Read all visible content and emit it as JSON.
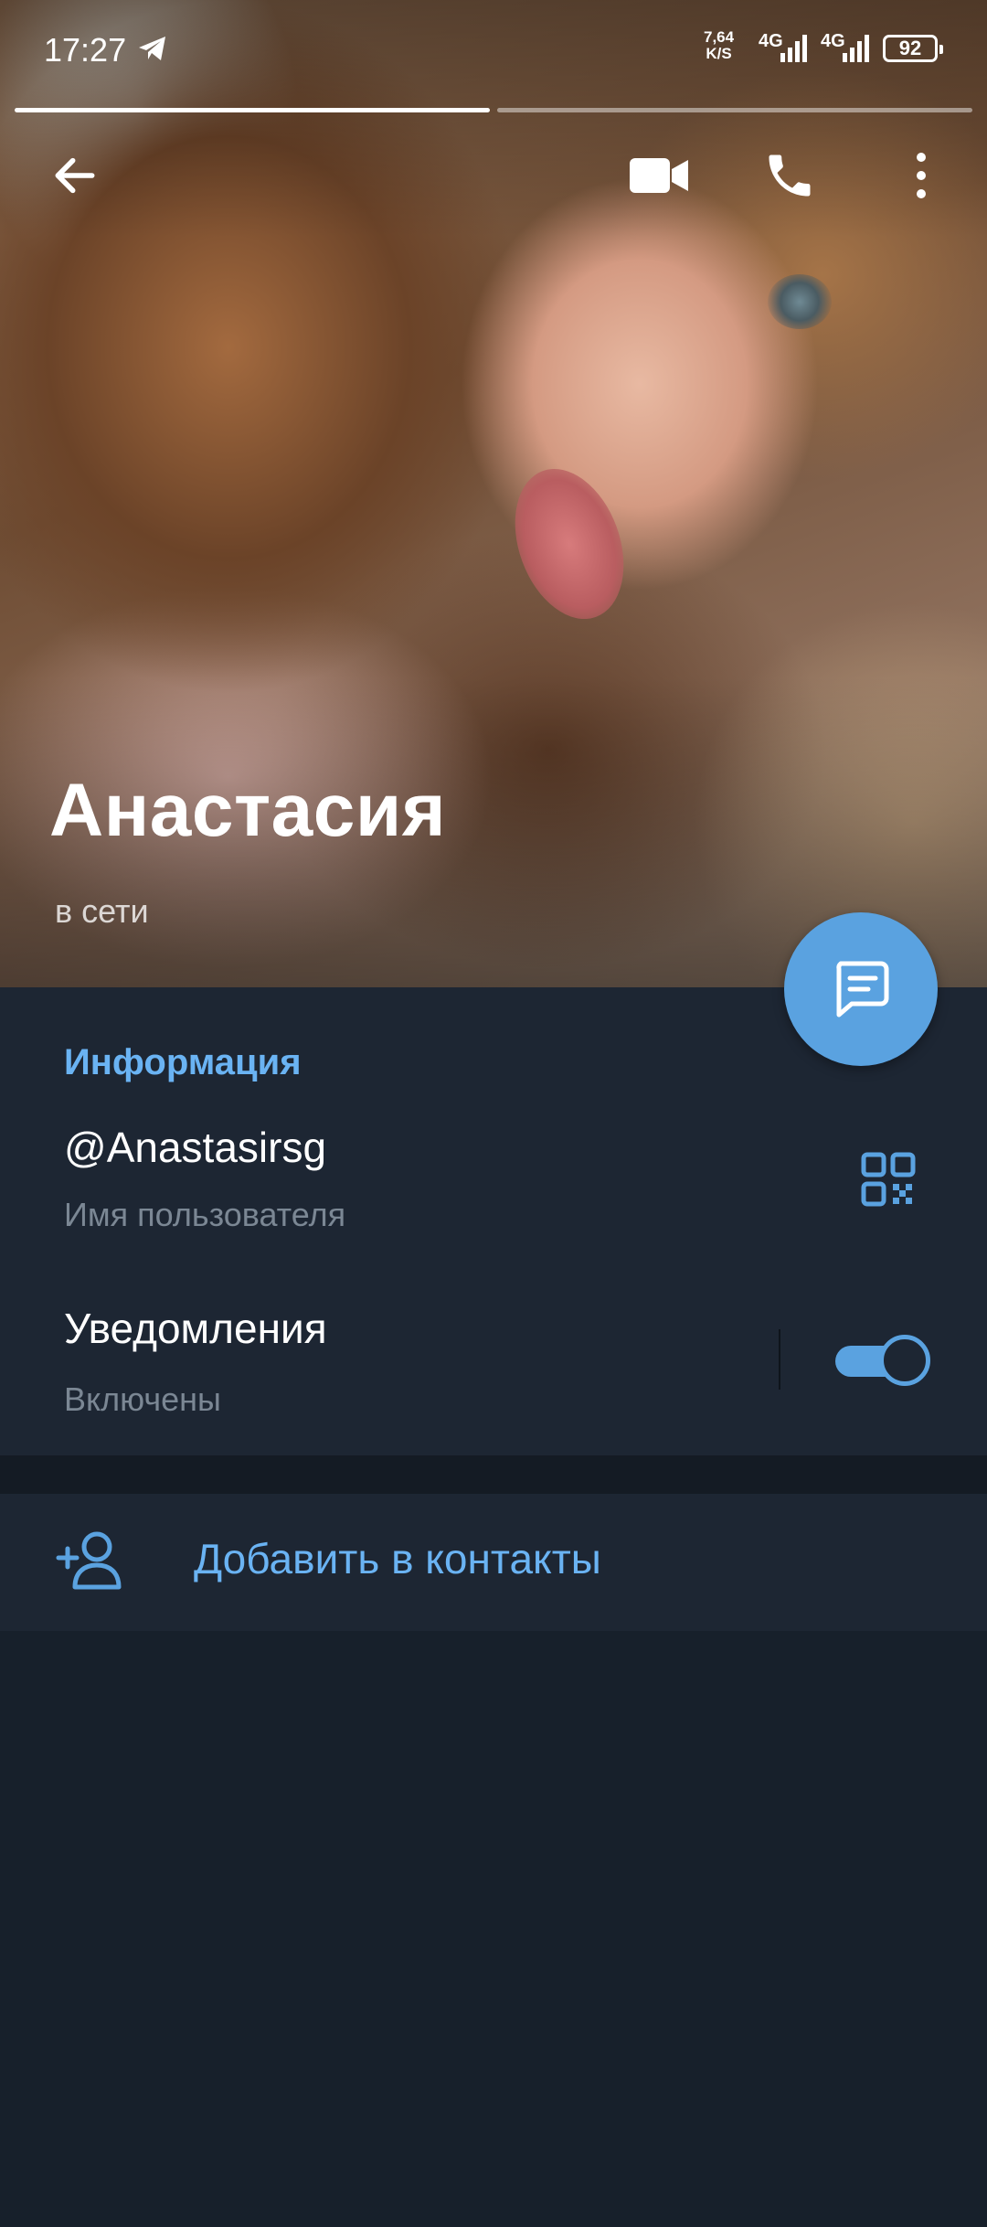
{
  "status_bar": {
    "time": "17:27",
    "speed_value": "7,64",
    "speed_unit": "K/S",
    "network_1": "4G",
    "network_2": "4G",
    "battery": "92"
  },
  "profile": {
    "name": "Анастасия",
    "presence": "в сети"
  },
  "info": {
    "section_title": "Информация",
    "username": "@Anastasirsg",
    "username_label": "Имя пользователя",
    "notifications_title": "Уведомления",
    "notifications_label": "Включены",
    "notifications_enabled": true
  },
  "actions": {
    "add_contact_label": "Добавить в контакты"
  },
  "stories": {
    "count": 2,
    "current": 1
  },
  "colors": {
    "accent": "#5aa2e0",
    "link": "#6ab3f3",
    "background": "#17202b",
    "card": "#1d2633"
  },
  "icons": {
    "back": "arrow-left-icon",
    "video": "video-camera-icon",
    "call": "phone-icon",
    "more": "more-vertical-icon",
    "message": "message-icon",
    "qr": "qr-code-icon",
    "add_contact": "add-person-icon"
  }
}
